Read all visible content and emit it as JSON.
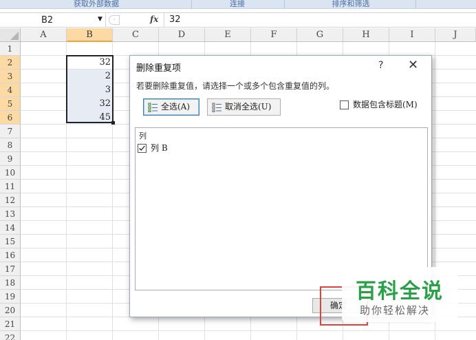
{
  "ribbon": {
    "groups": [
      "获取外部数据",
      "连接",
      "排序和筛选"
    ]
  },
  "formula_bar": {
    "name_box": "B2",
    "fx_label": "fx",
    "value": "32"
  },
  "sheet": {
    "columns": [
      "A",
      "B",
      "C",
      "D",
      "E",
      "F",
      "G",
      "H",
      "I",
      "J"
    ],
    "rows": [
      "1",
      "2",
      "3",
      "4",
      "5",
      "6",
      "7",
      "8",
      "9",
      "10",
      "11",
      "12",
      "13",
      "14",
      "15",
      "16",
      "17",
      "18",
      "19",
      "20",
      "21",
      "22"
    ],
    "selected_column": "B",
    "selected_range": "B2:B6",
    "values": [
      "32",
      "2",
      "3",
      "32",
      "45"
    ]
  },
  "dialog": {
    "title": "删除重复项",
    "help": "?",
    "close": "✕",
    "instruction": "若要删除重复值，请选择一个或多个包含重复值的列。",
    "select_all": "全选(A)",
    "unselect_all": "取消全选(U)",
    "has_headers": "数据包含标题(M)",
    "has_headers_checked": false,
    "list_header": "列",
    "columns": [
      {
        "label": "列 B",
        "checked": true
      }
    ],
    "ok": "确定"
  },
  "watermark": {
    "title": "百科全说",
    "subtitle": "助你轻松解决"
  },
  "colors": {
    "selection_header": "#fdd9a3",
    "selection_fill": "#e6ebf4",
    "highlight_box": "#e0413c",
    "watermark": "#2a9f48"
  }
}
